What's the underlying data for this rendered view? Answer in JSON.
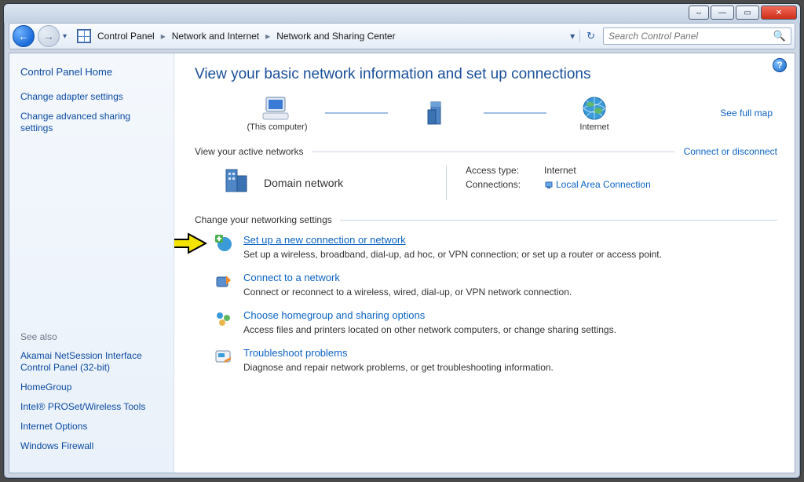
{
  "window": {
    "buttons": {
      "extra": "⇔",
      "min": "—",
      "max": "▭",
      "close": "✕"
    }
  },
  "nav": {
    "back_glyph": "←",
    "fwd_glyph": "→",
    "history_glyph": "▾",
    "breadcrumb": [
      "Control Panel",
      "Network and Internet",
      "Network and Sharing Center"
    ],
    "sep": "▸",
    "addr_drop": "▾",
    "refresh": "↻",
    "search_placeholder": "Search Control Panel"
  },
  "sidebar": {
    "home": "Control Panel Home",
    "links": [
      "Change adapter settings",
      "Change advanced sharing settings"
    ],
    "seealso_header": "See also",
    "seealso": [
      "Akamai NetSession Interface Control Panel (32-bit)",
      "HomeGroup",
      "Intel® PROSet/Wireless Tools",
      "Internet Options",
      "Windows Firewall"
    ]
  },
  "main": {
    "title": "View your basic network information and set up connections",
    "help": "?",
    "map": {
      "nodes": [
        "(This computer)",
        "",
        "Internet"
      ],
      "full_map": "See full map"
    },
    "active_header": "View your active networks",
    "connect_link": "Connect or disconnect",
    "active": {
      "name": "Domain network",
      "access_lbl": "Access type:",
      "access_val": "Internet",
      "conn_lbl": "Connections:",
      "conn_val": "Local Area Connection"
    },
    "change_header": "Change your networking settings",
    "tasks": [
      {
        "title": "Set up a new connection or network",
        "desc": "Set up a wireless, broadband, dial-up, ad hoc, or VPN connection; or set up a router or access point.",
        "underline": true
      },
      {
        "title": "Connect to a network",
        "desc": "Connect or reconnect to a wireless, wired, dial-up, or VPN network connection."
      },
      {
        "title": "Choose homegroup and sharing options",
        "desc": "Access files and printers located on other network computers, or change sharing settings."
      },
      {
        "title": "Troubleshoot problems",
        "desc": "Diagnose and repair network problems, or get troubleshooting information."
      }
    ]
  }
}
